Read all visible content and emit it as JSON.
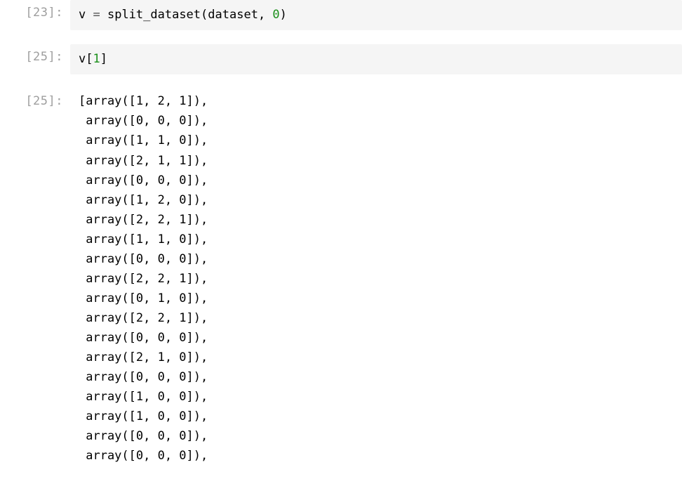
{
  "cells": [
    {
      "prompt": "[23]:",
      "type": "input",
      "code": {
        "var": "v",
        "assign": " = ",
        "fn": "split_dataset",
        "lparen": "(",
        "arg1": "dataset",
        "comma": ", ",
        "arg2": "0",
        "rparen": ")"
      }
    },
    {
      "prompt": "[25]:",
      "type": "input",
      "code": {
        "var": "v",
        "lbracket": "[",
        "index": "1",
        "rbracket": "]"
      }
    },
    {
      "prompt": "[25]:",
      "type": "output",
      "lines": [
        "[array([1, 2, 1]),",
        " array([0, 0, 0]),",
        " array([1, 1, 0]),",
        " array([2, 1, 1]),",
        " array([0, 0, 0]),",
        " array([1, 2, 0]),",
        " array([2, 2, 1]),",
        " array([1, 1, 0]),",
        " array([0, 0, 0]),",
        " array([2, 2, 1]),",
        " array([0, 1, 0]),",
        " array([2, 2, 1]),",
        " array([0, 0, 0]),",
        " array([2, 1, 0]),",
        " array([0, 0, 0]),",
        " array([1, 0, 0]),",
        " array([1, 0, 0]),",
        " array([0, 0, 0]),",
        " array([0, 0, 0]),"
      ]
    }
  ]
}
